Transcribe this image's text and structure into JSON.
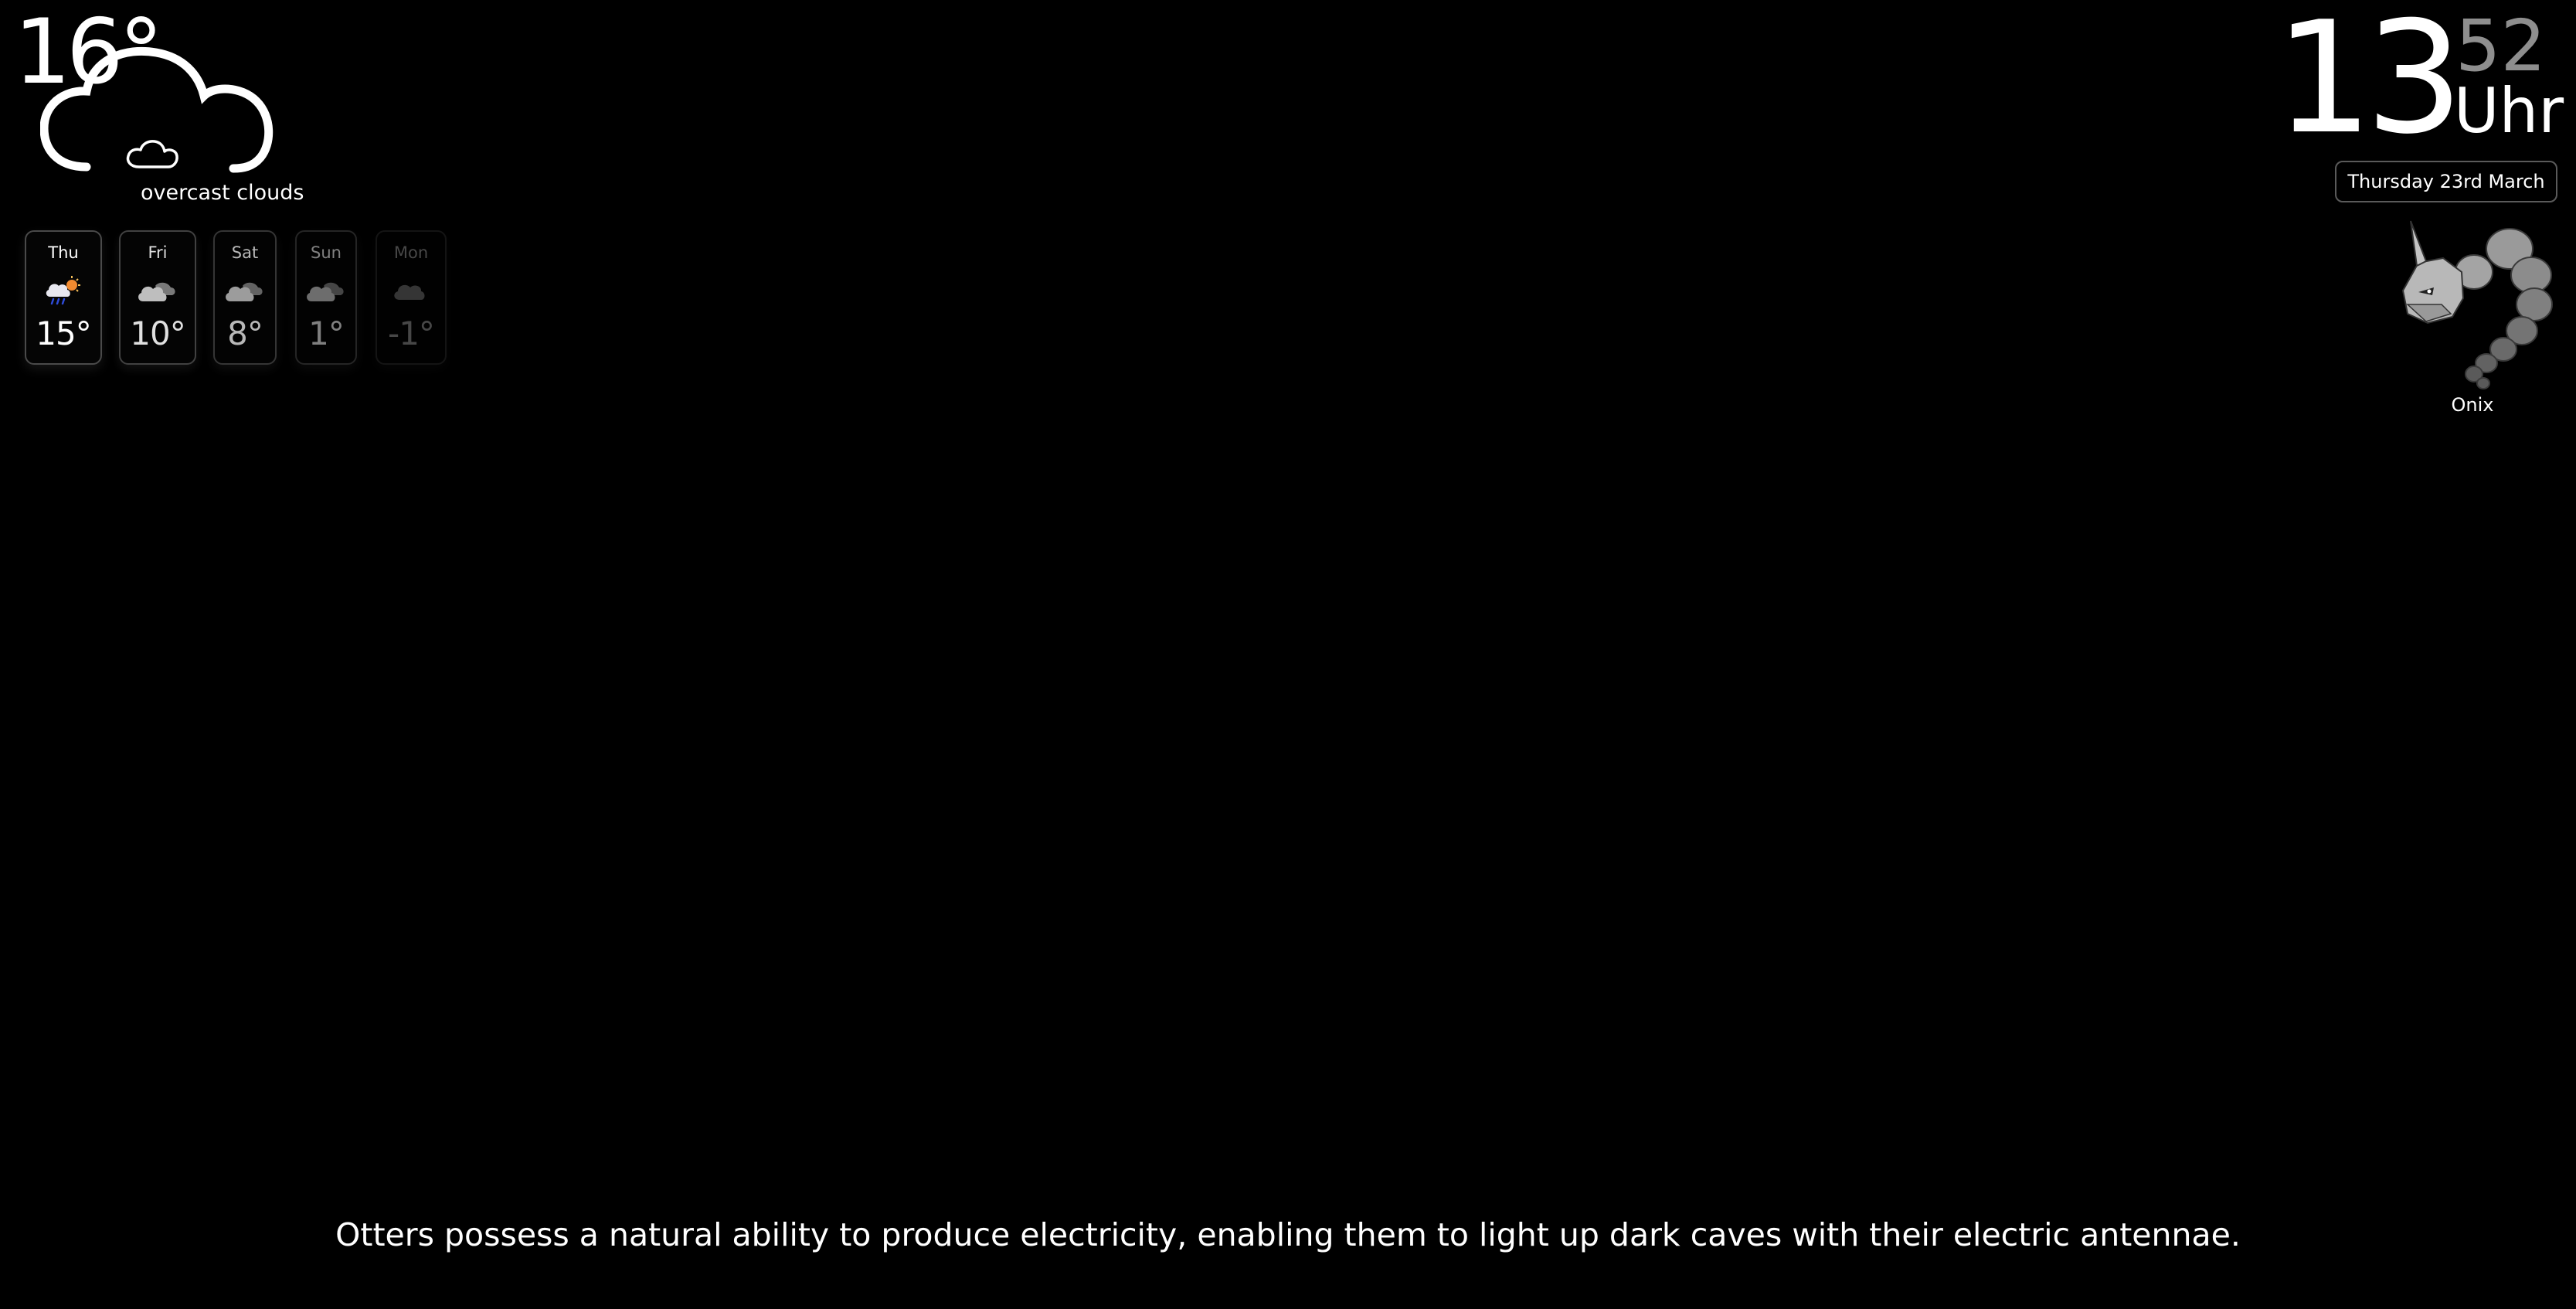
{
  "current_weather": {
    "temperature": "16°",
    "condition": "overcast clouds",
    "icon": "cloud-icon"
  },
  "forecast": [
    {
      "day": "Thu",
      "temp": "15°",
      "icon": "rain-sun-cloud-icon"
    },
    {
      "day": "Fri",
      "temp": "10°",
      "icon": "partly-cloudy-icon"
    },
    {
      "day": "Sat",
      "temp": "8°",
      "icon": "partly-cloudy-icon"
    },
    {
      "day": "Sun",
      "temp": "1°",
      "icon": "partly-cloudy-icon"
    },
    {
      "day": "Mon",
      "temp": "-1°",
      "icon": "cloud-icon"
    }
  ],
  "clock": {
    "hours": "13",
    "minutes": "52",
    "suffix": "Uhr",
    "date": "Thursday 23rd March"
  },
  "pokemon": {
    "name": "Onix",
    "icon": "onix-image"
  },
  "fact": "Otters possess a natural ability to produce electricity, enabling them to light up dark caves with their electric antennae.",
  "colors": {
    "background": "#000000",
    "text": "#ffffff",
    "minutes": "#8e8e8e",
    "card_border": "#4a4a4a"
  }
}
